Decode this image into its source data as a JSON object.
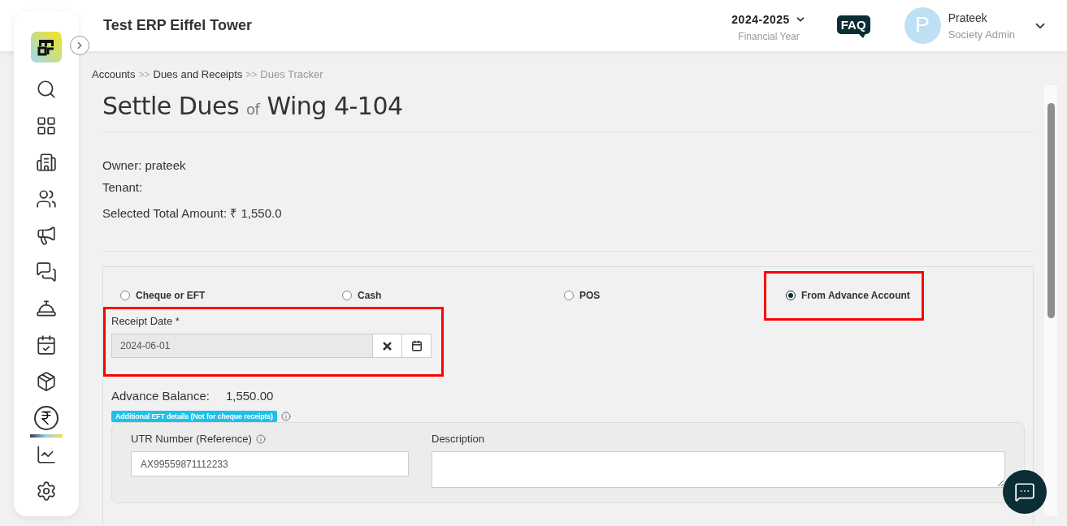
{
  "header": {
    "title": "Test ERP Eiffel Tower",
    "year": {
      "value": "2024-2025",
      "label": "Financial Year"
    },
    "faq": "FAQ",
    "user": {
      "initial": "P",
      "name": "Prateek",
      "role": "Society Admin"
    }
  },
  "sidebar": {
    "items": [
      {
        "kind": "search",
        "selected": false
      },
      {
        "kind": "dashboard",
        "selected": false
      },
      {
        "kind": "building",
        "selected": false
      },
      {
        "kind": "people",
        "selected": false
      },
      {
        "kind": "megaphone",
        "selected": false
      },
      {
        "kind": "chat",
        "selected": false
      },
      {
        "kind": "reception",
        "selected": false
      },
      {
        "kind": "calendar",
        "selected": false
      },
      {
        "kind": "box",
        "selected": false
      },
      {
        "kind": "rupee",
        "selected": true
      },
      {
        "kind": "report",
        "selected": false
      },
      {
        "kind": "settings",
        "selected": false
      }
    ]
  },
  "breadcrumb": [
    {
      "label": "Accounts",
      "current": false
    },
    {
      "label": "Dues and Receipts",
      "current": false
    },
    {
      "label": "Dues Tracker",
      "current": true
    }
  ],
  "breadcrumb_separator": ">>",
  "page": {
    "title": "Settle Dues",
    "connector": "of",
    "subject": "Wing 4-104"
  },
  "details": [
    "Owner: prateek",
    "Tenant:",
    "Selected Total Amount: ₹  1,550.0"
  ],
  "payment_modes": [
    {
      "label": "Cheque or EFT",
      "selected": false,
      "highlighted": false
    },
    {
      "label": "Cash",
      "selected": false,
      "highlighted": false
    },
    {
      "label": "POS",
      "selected": false,
      "highlighted": false
    },
    {
      "label": "From Advance Account",
      "selected": true,
      "highlighted": true
    }
  ],
  "receipt_date": {
    "label": "Receipt Date *",
    "value": "2024-06-01",
    "highlighted": true
  },
  "advance_balance": {
    "label": "Advance Balance:",
    "value": "1,550.00"
  },
  "eft": {
    "badge": "Additional EFT details (Not for cheque receipts)",
    "utr": {
      "label": "UTR Number (Reference)",
      "value": "AX99559871112233"
    },
    "description": {
      "label": "Description"
    }
  }
}
